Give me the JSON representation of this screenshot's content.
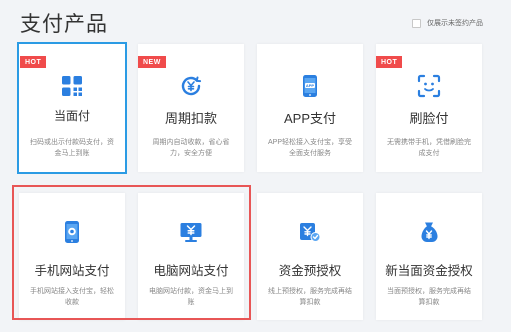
{
  "page": {
    "title": "支付产品",
    "filter_label": "仅展示未签约产品"
  },
  "colors": {
    "primary_blue": "#2b7fe0",
    "badge_red": "#f04b4b",
    "selected_border": "#2b9be4",
    "highlight_border": "#e85656"
  },
  "products": [
    {
      "name": "当面付",
      "desc": "扫码或出示付款码支付，资金马上到账",
      "badge": "HOT",
      "icon": "qr-code-icon"
    },
    {
      "name": "周期扣款",
      "desc": "周期内自动收款，省心省力，安全方便",
      "badge": "NEW",
      "icon": "cycle-yuan-icon"
    },
    {
      "name": "APP支付",
      "desc": "APP轻松接入支付宝，享受全面支付服务",
      "badge": "",
      "icon": "app-phone-icon"
    },
    {
      "name": "刷脸付",
      "desc": "无需携带手机，凭借刷脸完成支付",
      "badge": "HOT",
      "icon": "face-scan-icon"
    },
    {
      "name": "手机网站支付",
      "desc": "手机网站接入支付宝，轻松收款",
      "badge": "",
      "icon": "mobile-site-icon"
    },
    {
      "name": "电脑网站支付",
      "desc": "电脑网站付款，资金马上到账",
      "badge": "",
      "icon": "pc-site-icon"
    },
    {
      "name": "资金预授权",
      "desc": "线上预授权，服务完成再结算扣款",
      "badge": "",
      "icon": "preauth-icon"
    },
    {
      "name": "新当面资金授权",
      "desc": "当面预授权，服务完成再结算扣款",
      "badge": "",
      "icon": "money-bag-icon"
    }
  ]
}
